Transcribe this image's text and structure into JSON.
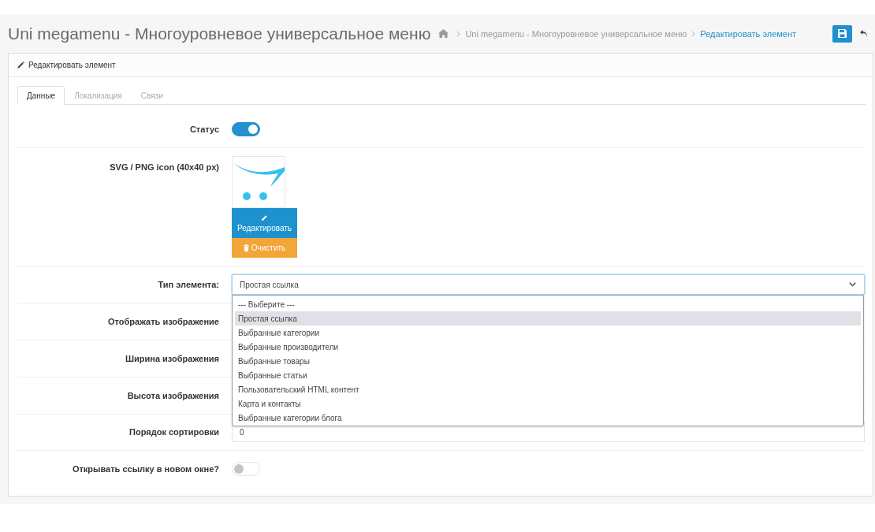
{
  "header": {
    "title": "Uni megamenu - Многоуровневое универсальное меню",
    "breadcrumbs": [
      {
        "label": "Uni megamenu - Многоуровневое универсальное меню",
        "active": false
      },
      {
        "label": "Редактировать элемент",
        "active": true
      }
    ]
  },
  "panel": {
    "title": "Редактировать элемент",
    "tabs": [
      {
        "label": "Данные",
        "selected": true
      },
      {
        "label": "Локализация",
        "selected": false
      },
      {
        "label": "Связи",
        "selected": false
      }
    ],
    "rows": [
      {
        "kind": "toggle",
        "label": "Статус",
        "on": true
      },
      {
        "kind": "image",
        "label": "SVG / PNG icon (40x40 px)",
        "edit_button": "Редактировать",
        "clear_button": "Очистить"
      },
      {
        "kind": "select",
        "label": "Тип элемента:",
        "value": "Простая ссылка",
        "expanded": true,
        "options": [
          {
            "label": "--- Выберите ---",
            "selected": false
          },
          {
            "label": "Простая ссылка",
            "selected": true
          },
          {
            "label": "Выбранные категории",
            "selected": false
          },
          {
            "label": "Выбранные производители",
            "selected": false
          },
          {
            "label": "Выбранные товары",
            "selected": false
          },
          {
            "label": "Выбранные статьи",
            "selected": false
          },
          {
            "label": "Пользовательский HTML контент",
            "selected": false
          },
          {
            "label": "Карта и контакты",
            "selected": false
          },
          {
            "label": "Выбранные категории блога",
            "selected": false
          }
        ]
      },
      {
        "kind": "label_only",
        "label": "Отображать изображение"
      },
      {
        "kind": "label_only",
        "label": "Ширина изображения"
      },
      {
        "kind": "label_only",
        "label": "Высота изображения"
      },
      {
        "kind": "input",
        "label": "Порядок сортировки",
        "value": "0"
      },
      {
        "kind": "toggle",
        "label": "Открывать ссылку в новом окне?",
        "on": false
      }
    ]
  }
}
